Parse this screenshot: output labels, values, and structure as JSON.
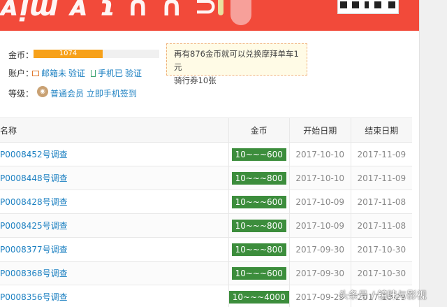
{
  "banner": {
    "text": "ᴀᴉɯ ᴀ ɿ ∩ ∩ ⊃",
    "color": "#f24a3a"
  },
  "account": {
    "coin_label": "金币：",
    "coin_value": "1074",
    "coin_progress_percent": 55,
    "account_label": "账户：",
    "email_text": "邮箱未",
    "email_action": "验证",
    "phone_text": "手机已",
    "phone_action": "验证",
    "level_label": "等级：",
    "level_name": "普通会员",
    "level_action": "立即手机签到"
  },
  "tip": {
    "line1": "再有876金币就可以兑换摩拜单车1元",
    "line2": "骑行券10张"
  },
  "table": {
    "headers": {
      "name": "名称",
      "coin": "金币",
      "start": "开始日期",
      "end": "结束日期"
    },
    "rows": [
      {
        "name": "P0008452号调查",
        "coin": "10~~~600",
        "start": "2017-10-10",
        "end": "2017-11-09"
      },
      {
        "name": "P0008448号调查",
        "coin": "10~~~800",
        "start": "2017-10-10",
        "end": "2017-11-09"
      },
      {
        "name": "P0008428号调查",
        "coin": "10~~~600",
        "start": "2017-10-09",
        "end": "2017-11-08"
      },
      {
        "name": "P0008425号调查",
        "coin": "10~~~800",
        "start": "2017-10-09",
        "end": "2017-11-08"
      },
      {
        "name": "P0008377号调查",
        "coin": "10~~~800",
        "start": "2017-09-30",
        "end": "2017-10-30"
      },
      {
        "name": "P0008368号调查",
        "coin": "10~~~600",
        "start": "2017-09-30",
        "end": "2017-10-30"
      },
      {
        "name": "P0008356号调查",
        "coin": "10~~~4000",
        "start": "2017-09-29",
        "end": "2017-10-29"
      }
    ]
  },
  "watermark": "头条号 / 镜睐与影视",
  "colors": {
    "link": "#1a7fc1",
    "coin_pill": "#3c8d3c",
    "progress": "#f7a11a"
  }
}
